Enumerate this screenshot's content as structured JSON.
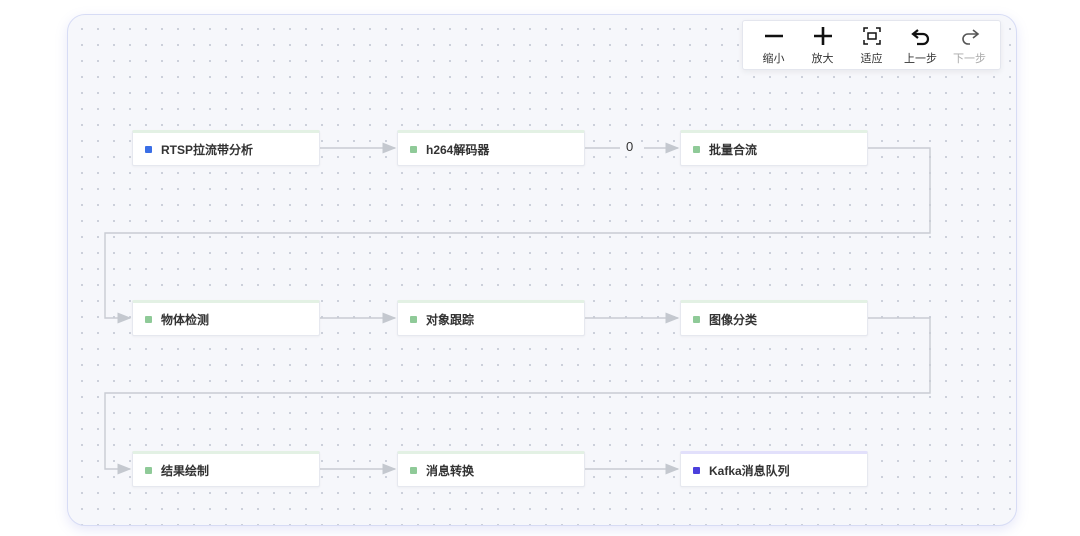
{
  "toolbar": {
    "zoom_out": "缩小",
    "zoom_in": "放大",
    "fit": "适应",
    "undo": "上一步",
    "redo": "下一步"
  },
  "colors": {
    "accent_green": "#8fca98",
    "source_blue": "#3b6fe6",
    "sink_purple": "#4b3fdc"
  },
  "nodes": [
    {
      "id": "rtsp",
      "label": "RTSP拉流带分析",
      "dot": "#3b6fe6"
    },
    {
      "id": "h264",
      "label": "h264解码器",
      "dot": "#8fca98"
    },
    {
      "id": "batch",
      "label": "批量合流",
      "dot": "#8fca98"
    },
    {
      "id": "detect",
      "label": "物体检测",
      "dot": "#8fca98"
    },
    {
      "id": "track",
      "label": "对象跟踪",
      "dot": "#8fca98"
    },
    {
      "id": "classify",
      "label": "图像分类",
      "dot": "#8fca98"
    },
    {
      "id": "draw",
      "label": "结果绘制",
      "dot": "#8fca98"
    },
    {
      "id": "convert",
      "label": "消息转换",
      "dot": "#8fca98"
    },
    {
      "id": "kafka",
      "label": "Kafka消息队列",
      "dot": "#4b3fdc"
    }
  ],
  "edge_labels": {
    "h264_to_batch": "0"
  }
}
